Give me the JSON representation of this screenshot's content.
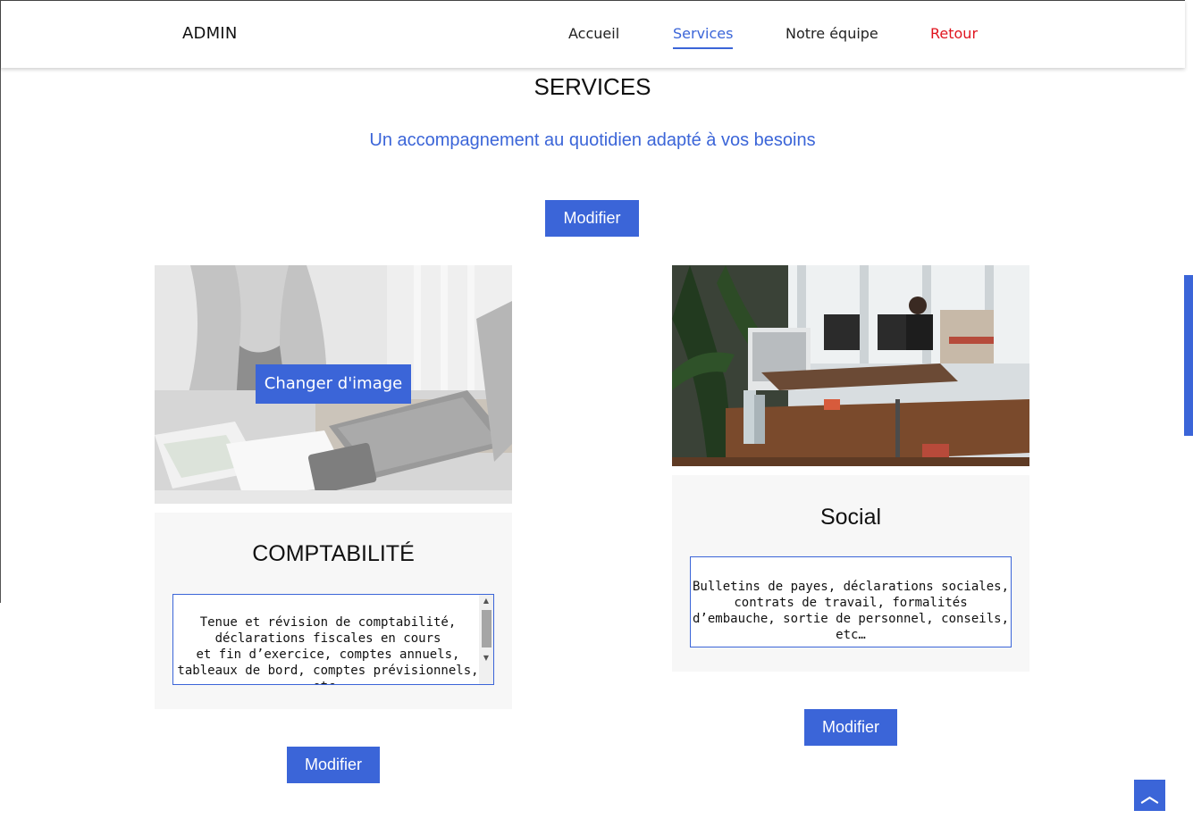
{
  "header": {
    "brand": "ADMIN",
    "nav": [
      {
        "label": "Accueil"
      },
      {
        "label": "Services"
      },
      {
        "label": "Notre équipe"
      },
      {
        "label": "Retour"
      }
    ]
  },
  "main": {
    "title": "SERVICES",
    "subtitle": "Un accompagnement au quotidien adapté à vos besoins",
    "modify_label": "Modifier"
  },
  "cards": [
    {
      "title": "COMPTABILITÉ",
      "text": "Tenue et révision de comptabilité,\ndéclarations fiscales en cours\net fin d’exercice, comptes annuels,\ntableaux de bord, comptes prévisionnels,\netc…",
      "change_image_label": "Changer d'image",
      "modify_label": "Modifier"
    },
    {
      "title": "Social",
      "text": "Bulletins de payes, déclarations sociales,\ncontrats de travail, formalités\nd’embauche, sortie de personnel, conseils,\netc…",
      "modify_label": "Modifier"
    }
  ],
  "colors": {
    "accent": "#3b65d8",
    "back_link": "#e0141e",
    "card_bg": "#f7f7f7"
  },
  "icons": {
    "back_to_top": "chevron-up-icon"
  }
}
